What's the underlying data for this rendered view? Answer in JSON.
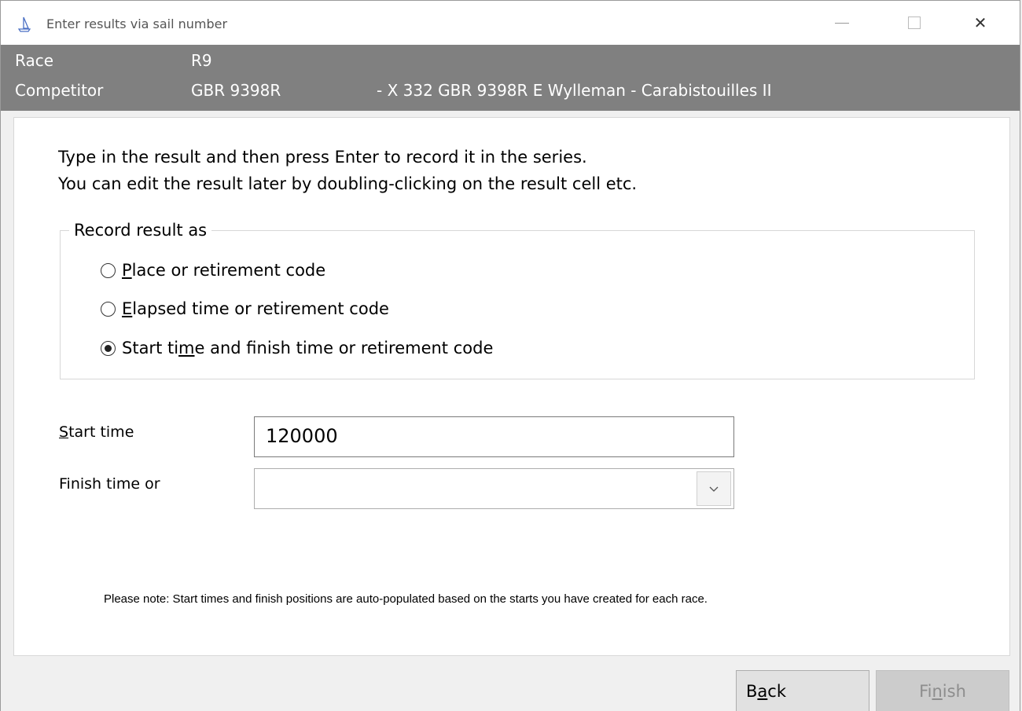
{
  "window": {
    "title": "Enter results via sail number",
    "app_icon": "sailboat-icon",
    "controls": {
      "minimize_icon": "minimize-icon",
      "maximize_icon": "maximize-icon",
      "close_icon": "close-icon",
      "close_glyph": "✕"
    }
  },
  "header": {
    "race_label": "Race",
    "race_value": "R9",
    "competitor_label": "Competitor",
    "competitor_value": "GBR 9398R",
    "competitor_details": "- X 332 GBR 9398R E Wylleman - Carabistouilles II",
    "background_color": "#808080"
  },
  "instructions": {
    "line1": "Type in the result and then press Enter to record it in the series.",
    "line2": "You can edit the result later by doubling-clicking on the result cell etc."
  },
  "record_group": {
    "legend": "Record result as",
    "options": [
      {
        "before": "",
        "mnemonic": "P",
        "after": "lace or retirement code",
        "checked": false
      },
      {
        "before": "",
        "mnemonic": "E",
        "after": "lapsed time or retirement code",
        "checked": false
      },
      {
        "before": "Start ti",
        "mnemonic": "m",
        "after": "e and finish time or retirement code",
        "checked": true
      }
    ]
  },
  "fields": {
    "start_time_mnemonic": "S",
    "start_time_label_rest": "tart time",
    "start_time_value": "120000",
    "finish_label": "Finish time or",
    "finish_value": "",
    "dropdown_icon": "chevron-down-icon"
  },
  "note": "Please note: Start times and finish positions are auto-populated based on the starts you have created for each race.",
  "buttons": {
    "back_before": "B",
    "back_mnemonic": "a",
    "back_after": "ck",
    "finish_before": "Fi",
    "finish_mnemonic": "n",
    "finish_after": "ish",
    "finish_enabled": false
  }
}
